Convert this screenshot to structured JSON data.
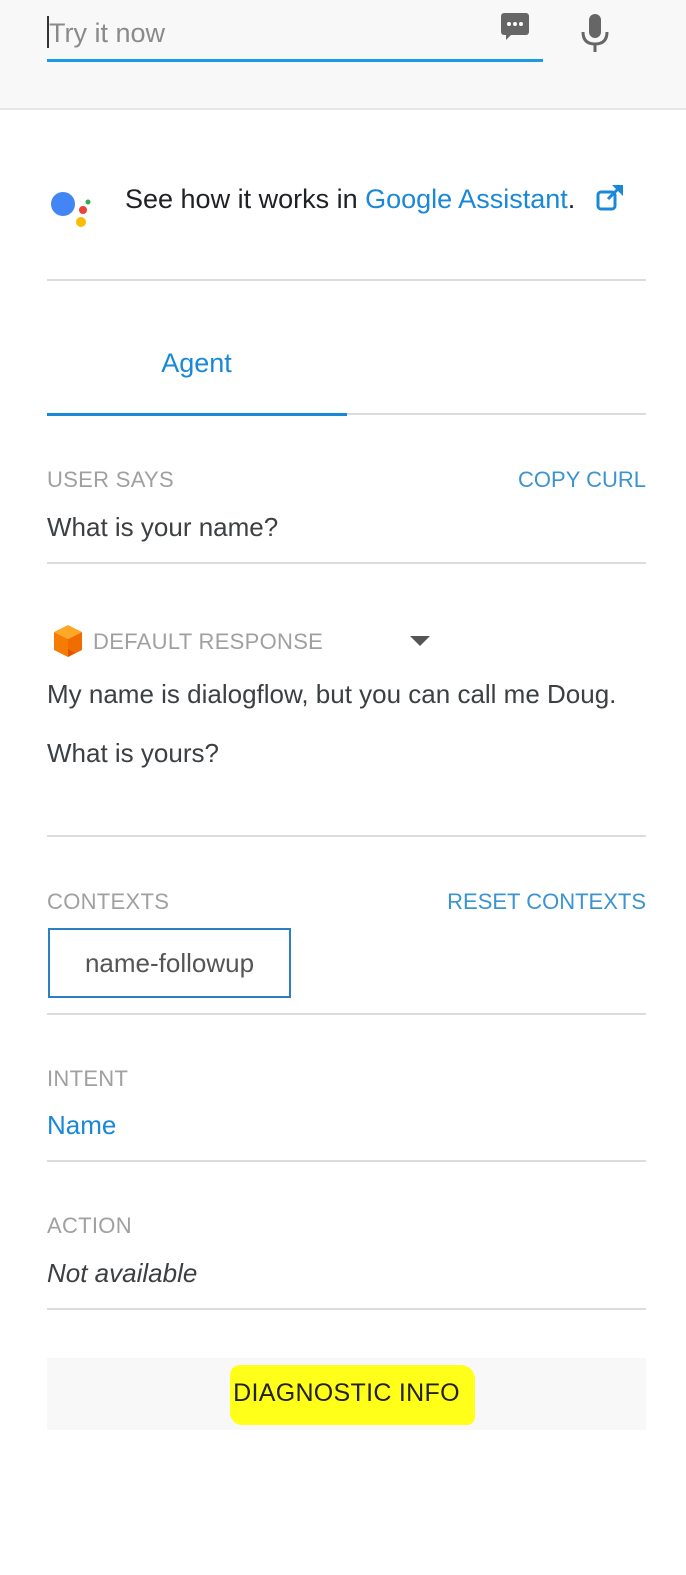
{
  "try_input": {
    "placeholder": "Try it now"
  },
  "assistant": {
    "prefix": "See how it works in ",
    "link_text": "Google Assistant",
    "suffix": "."
  },
  "tabs": [
    {
      "label": "Agent",
      "active": true
    }
  ],
  "user_says": {
    "label": "USER SAYS",
    "copy_curl": "COPY CURL",
    "value": "What is your name?"
  },
  "default_response": {
    "label": "DEFAULT RESPONSE",
    "lines": [
      "My name is dialogflow, but you can call me Doug.",
      "What is yours?"
    ]
  },
  "contexts": {
    "label": "CONTEXTS",
    "reset": "RESET CONTEXTS",
    "items": [
      "name-followup"
    ]
  },
  "intent": {
    "label": "INTENT",
    "value": "Name"
  },
  "action": {
    "label": "ACTION",
    "value": "Not available"
  },
  "diagnostic": {
    "label": "DIAGNOSTIC INFO"
  },
  "colors": {
    "accent": "#1a88d8",
    "input_underline": "#1a9be6",
    "highlight": "#ffff1a",
    "cube": "#f57c00"
  },
  "icons": {
    "chat": "chat-bubble-icon",
    "mic": "microphone-icon",
    "assistant": "google-assistant-logo-icon",
    "external": "external-link-icon",
    "cube": "dialogflow-cube-icon",
    "dropdown": "caret-down-icon"
  }
}
